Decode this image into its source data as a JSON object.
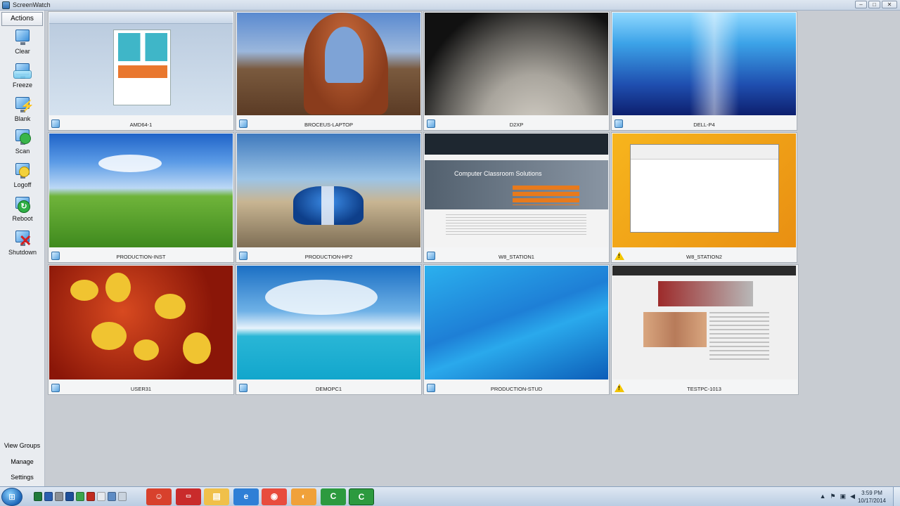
{
  "window": {
    "title": "ScreenWatch",
    "buttons": [
      "–",
      "□",
      "✕"
    ]
  },
  "sidebar": {
    "header": "Actions",
    "actions": [
      {
        "label": "Clear",
        "icon": "clear-monitor-icon"
      },
      {
        "label": "Freeze",
        "icon": "freeze-monitor-icon"
      },
      {
        "label": "Blank",
        "icon": "blank-monitor-icon"
      },
      {
        "label": "Scan",
        "icon": "scan-monitor-icon"
      },
      {
        "label": "Logoff",
        "icon": "logoff-key-icon"
      },
      {
        "label": "Reboot",
        "icon": "reboot-icon"
      },
      {
        "label": "Shutdown",
        "icon": "shutdown-icon"
      }
    ],
    "bottom": [
      "View Groups",
      "Manage",
      "Settings"
    ]
  },
  "computers": [
    {
      "name": "AMD64-1",
      "status": "ok"
    },
    {
      "name": "BROCEUS-LAPTOP",
      "status": "ok"
    },
    {
      "name": "D2XP",
      "status": "ok"
    },
    {
      "name": "DELL-P4",
      "status": "ok"
    },
    {
      "name": "PRODUCTION-INST",
      "status": "ok"
    },
    {
      "name": "PRODUCTION-HP2",
      "status": "ok"
    },
    {
      "name": "W8_STATION1",
      "status": "ok"
    },
    {
      "name": "W8_STATION2",
      "status": "warning"
    },
    {
      "name": "USER31",
      "status": "ok"
    },
    {
      "name": "DEMOPC1",
      "status": "ok"
    },
    {
      "name": "PRODUCTION-STUD",
      "status": "ok"
    },
    {
      "name": "TESTPC-1013",
      "status": "warning"
    }
  ],
  "thumbnail_text": {
    "web_hero": "Computer Classroom Solutions",
    "web_phone": "Call Now 800.237.5465"
  },
  "taskbar": {
    "clock_time": "3:59 PM",
    "clock_date": "10/17/2014"
  },
  "colors": {
    "accent": "#2d6db3",
    "warning": "#f2c400",
    "tile_border": "#a9b0b8"
  }
}
